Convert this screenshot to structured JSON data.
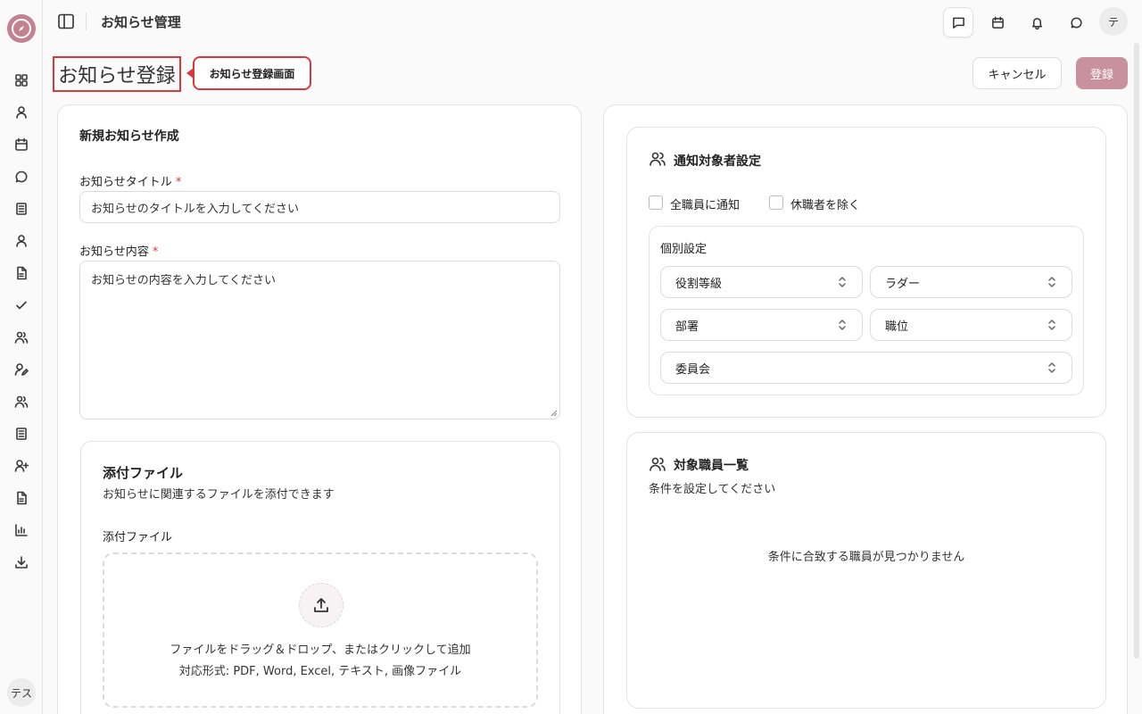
{
  "sidebar": {
    "logo": "compass-logo",
    "items": [
      {
        "icon": "dashboard-icon"
      },
      {
        "icon": "user-icon"
      },
      {
        "icon": "calendar-icon"
      },
      {
        "icon": "chat-icon"
      },
      {
        "icon": "notebook-icon"
      },
      {
        "icon": "user-icon"
      },
      {
        "icon": "document-icon"
      },
      {
        "icon": "check-icon"
      },
      {
        "icon": "users-icon"
      },
      {
        "icon": "user-edit-icon"
      },
      {
        "icon": "users-icon"
      },
      {
        "icon": "notebook-icon"
      },
      {
        "icon": "user-plus-icon"
      },
      {
        "icon": "document-icon"
      },
      {
        "icon": "bar-chart-icon"
      },
      {
        "icon": "download-icon"
      }
    ],
    "avatar_label": "テス"
  },
  "header": {
    "title": "お知らせ管理",
    "user_avatar": "テ",
    "icons": [
      "message-square-icon",
      "calendar-icon",
      "bell-icon",
      "chat-icon"
    ]
  },
  "page": {
    "title": "お知らせ登録",
    "callout": "お知らせ登録画面",
    "cancel_label": "キャンセル",
    "register_label": "登録"
  },
  "form": {
    "section_title": "新規お知らせ作成",
    "title_label": "お知らせタイトル",
    "required_mark": "*",
    "title_placeholder": "お知らせのタイトルを入力してください",
    "content_label": "お知らせ内容",
    "content_placeholder": "お知らせの内容を入力してください",
    "attach": {
      "title": "添付ファイル",
      "description": "お知らせに関連するファイルを添付できます",
      "field_label": "添付ファイル",
      "drop_text": "ファイルをドラッグ＆ドロップ、またはクリックして追加",
      "formats_text": "対応形式: PDF, Word, Excel, テキスト, 画像ファイル"
    }
  },
  "notify": {
    "title": "通知対象者設定",
    "checkbox_all": "全職員に通知",
    "checkbox_exclude": "休職者を除く",
    "individual_title": "個別設定",
    "selects": {
      "role_grade": "役割等級",
      "ladder": "ラダー",
      "department": "部署",
      "position": "職位",
      "committee": "委員会"
    }
  },
  "targets": {
    "title": "対象職員一覧",
    "subtitle": "条件を設定してください",
    "empty": "条件に合致する職員が見つかりません"
  },
  "colors": {
    "accent": "#c3808e",
    "register_button": "#c9919e",
    "highlight_border": "#d9383d"
  }
}
